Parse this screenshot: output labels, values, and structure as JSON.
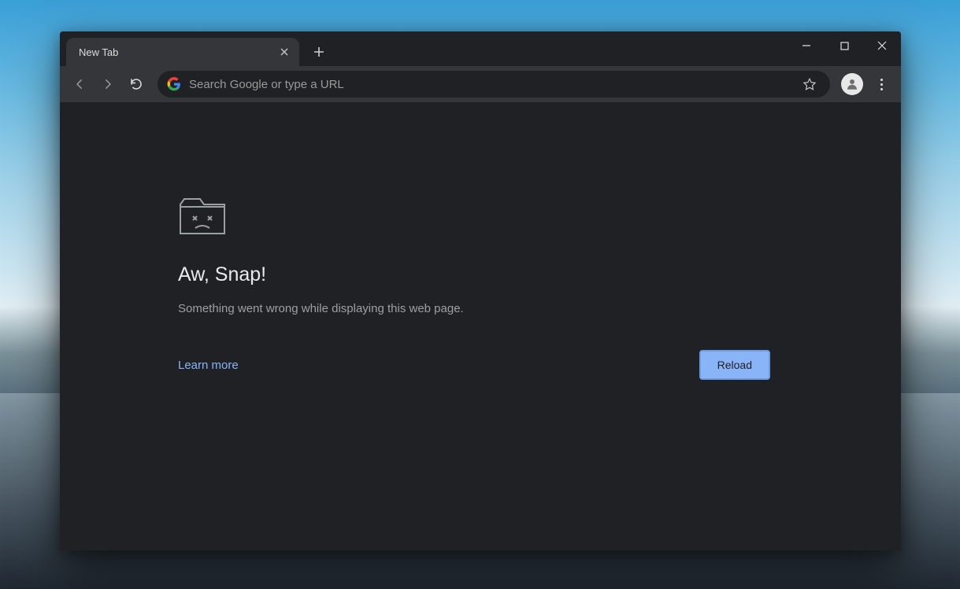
{
  "tab": {
    "title": "New Tab"
  },
  "omnibox": {
    "placeholder": "Search Google or type a URL",
    "value": ""
  },
  "error": {
    "title": "Aw, Snap!",
    "message": "Something went wrong while displaying this web page.",
    "learn_more": "Learn more",
    "reload": "Reload"
  },
  "colors": {
    "accent": "#8ab4f8",
    "bg": "#202124",
    "toolbar": "#35363a",
    "text_muted": "#9aa0a6"
  }
}
